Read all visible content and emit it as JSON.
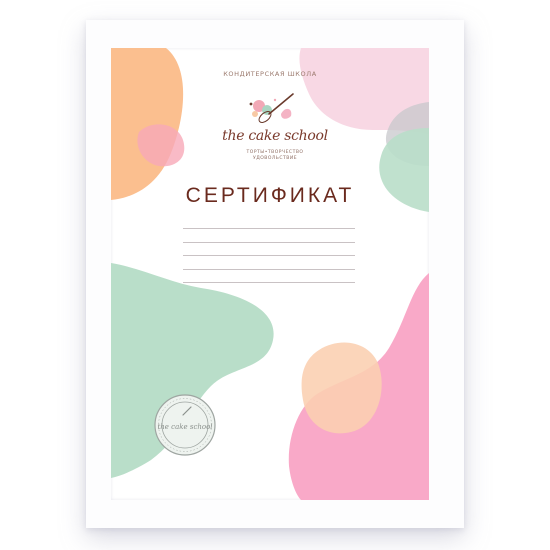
{
  "certificate": {
    "school_type": "КОНДИТЕРСКАЯ ШКОЛА",
    "logo_text": "the cake school",
    "tagline_line1": "ТОРТЫ•ТВОРЧЕСТВО",
    "tagline_line2": "УДОВОЛЬСТВИЕ",
    "title": "СЕРТИФИКАТ",
    "name_lines": 5
  },
  "stamp": {
    "logo_text": "the cake school"
  },
  "colors": {
    "frame": "#fdfdfe",
    "paper": "#ffffff",
    "peach": "#fbbf8f",
    "mint": "#b9dec9",
    "pink": "#f9a9c8",
    "light_pink": "#f7d5e1",
    "grey": "#c8c8cc",
    "title": "#6a2a1e"
  }
}
